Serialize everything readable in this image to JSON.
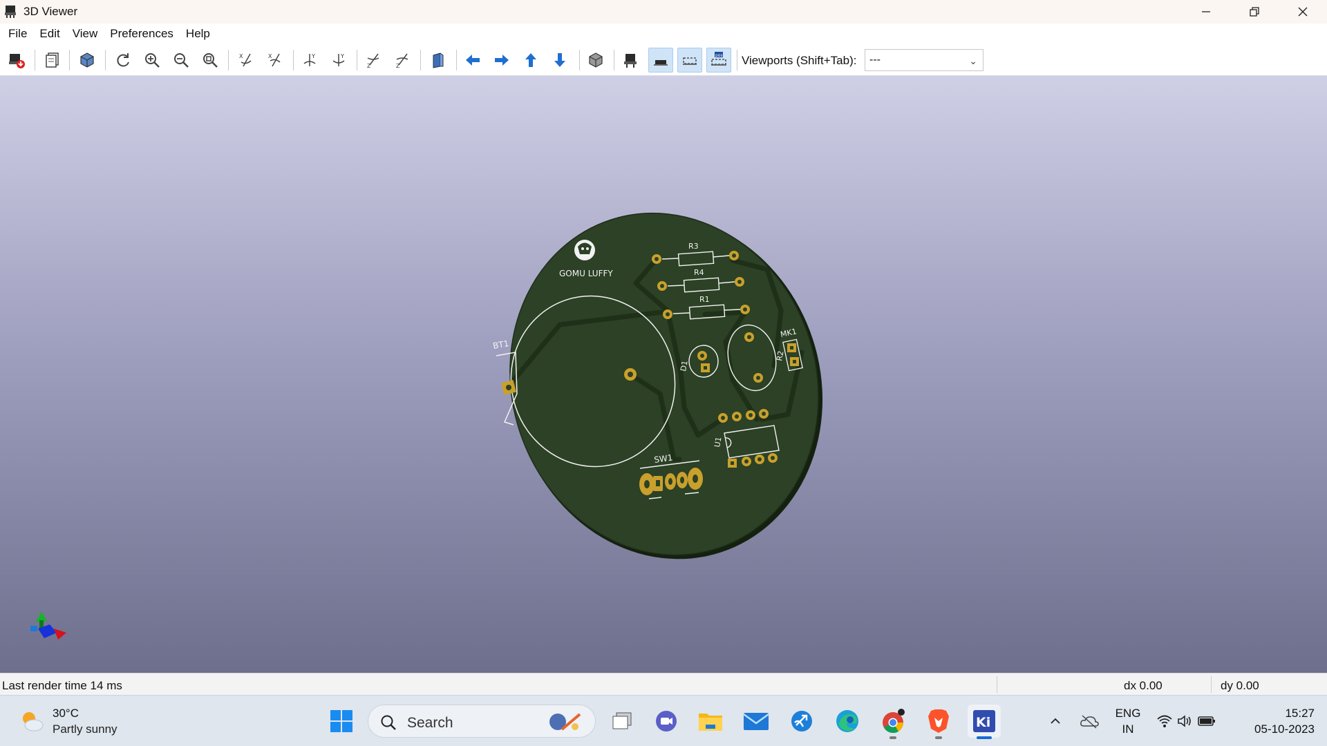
{
  "window": {
    "title": "3D Viewer",
    "app_icon": "kicad-3d-viewer-icon",
    "controls": [
      "minimize-icon",
      "restore-icon",
      "close-icon"
    ]
  },
  "menu": [
    "File",
    "Edit",
    "View",
    "Preferences",
    "Help"
  ],
  "toolbar": {
    "tools": [
      {
        "name": "reload-board-icon"
      },
      {
        "name": "copy-image-icon"
      },
      {
        "name": "3d-box-icon"
      },
      {
        "name": "refresh-icon"
      },
      {
        "name": "zoom-in-icon"
      },
      {
        "name": "zoom-out-icon"
      },
      {
        "name": "zoom-fit-icon"
      },
      {
        "name": "rotate-x-cw-icon"
      },
      {
        "name": "rotate-x-ccw-icon"
      },
      {
        "name": "rotate-y-cw-icon"
      },
      {
        "name": "rotate-y-ccw-icon"
      },
      {
        "name": "rotate-z-cw-icon"
      },
      {
        "name": "rotate-z-ccw-icon"
      },
      {
        "name": "flip-board-icon"
      },
      {
        "name": "move-left-icon"
      },
      {
        "name": "move-right-icon"
      },
      {
        "name": "move-up-icon"
      },
      {
        "name": "move-down-icon"
      },
      {
        "name": "ortho-toggle-icon"
      },
      {
        "name": "show-tht-icon"
      },
      {
        "name": "show-smd-icon",
        "active": true
      },
      {
        "name": "show-virtual-icon",
        "active": true
      },
      {
        "name": "show-not-in-pos-icon",
        "active": true
      }
    ],
    "viewports_label": "Viewports (Shift+Tab):",
    "viewports_value": "---"
  },
  "board": {
    "logo_text": "GOMU LUFFY",
    "refs": [
      "R3",
      "R4",
      "R1",
      "BT1",
      "D1",
      "MK1",
      "R2",
      "U1",
      "SW1"
    ],
    "colors": {
      "soldermask": "#2c4125",
      "silkscreen": "#f2f2f2",
      "pad": "#c9a02c",
      "edge": "#16220f"
    }
  },
  "status": {
    "render_time": "Last render time 14 ms",
    "dx": "dx 0.00",
    "dy": "dy 0.00"
  },
  "taskbar": {
    "weather_temp": "30°C",
    "weather_desc": "Partly sunny",
    "search_label": "Search",
    "apps": [
      "windows-start-icon",
      "task-view-icon",
      "meet-icon",
      "file-explorer-icon",
      "mail-icon",
      "network-app-icon",
      "edge-icon",
      "chrome-icon",
      "brave-icon",
      "kicad-icon"
    ],
    "lang_top": "ENG",
    "lang_bottom": "IN",
    "time": "15:27",
    "date": "05-10-2023"
  }
}
